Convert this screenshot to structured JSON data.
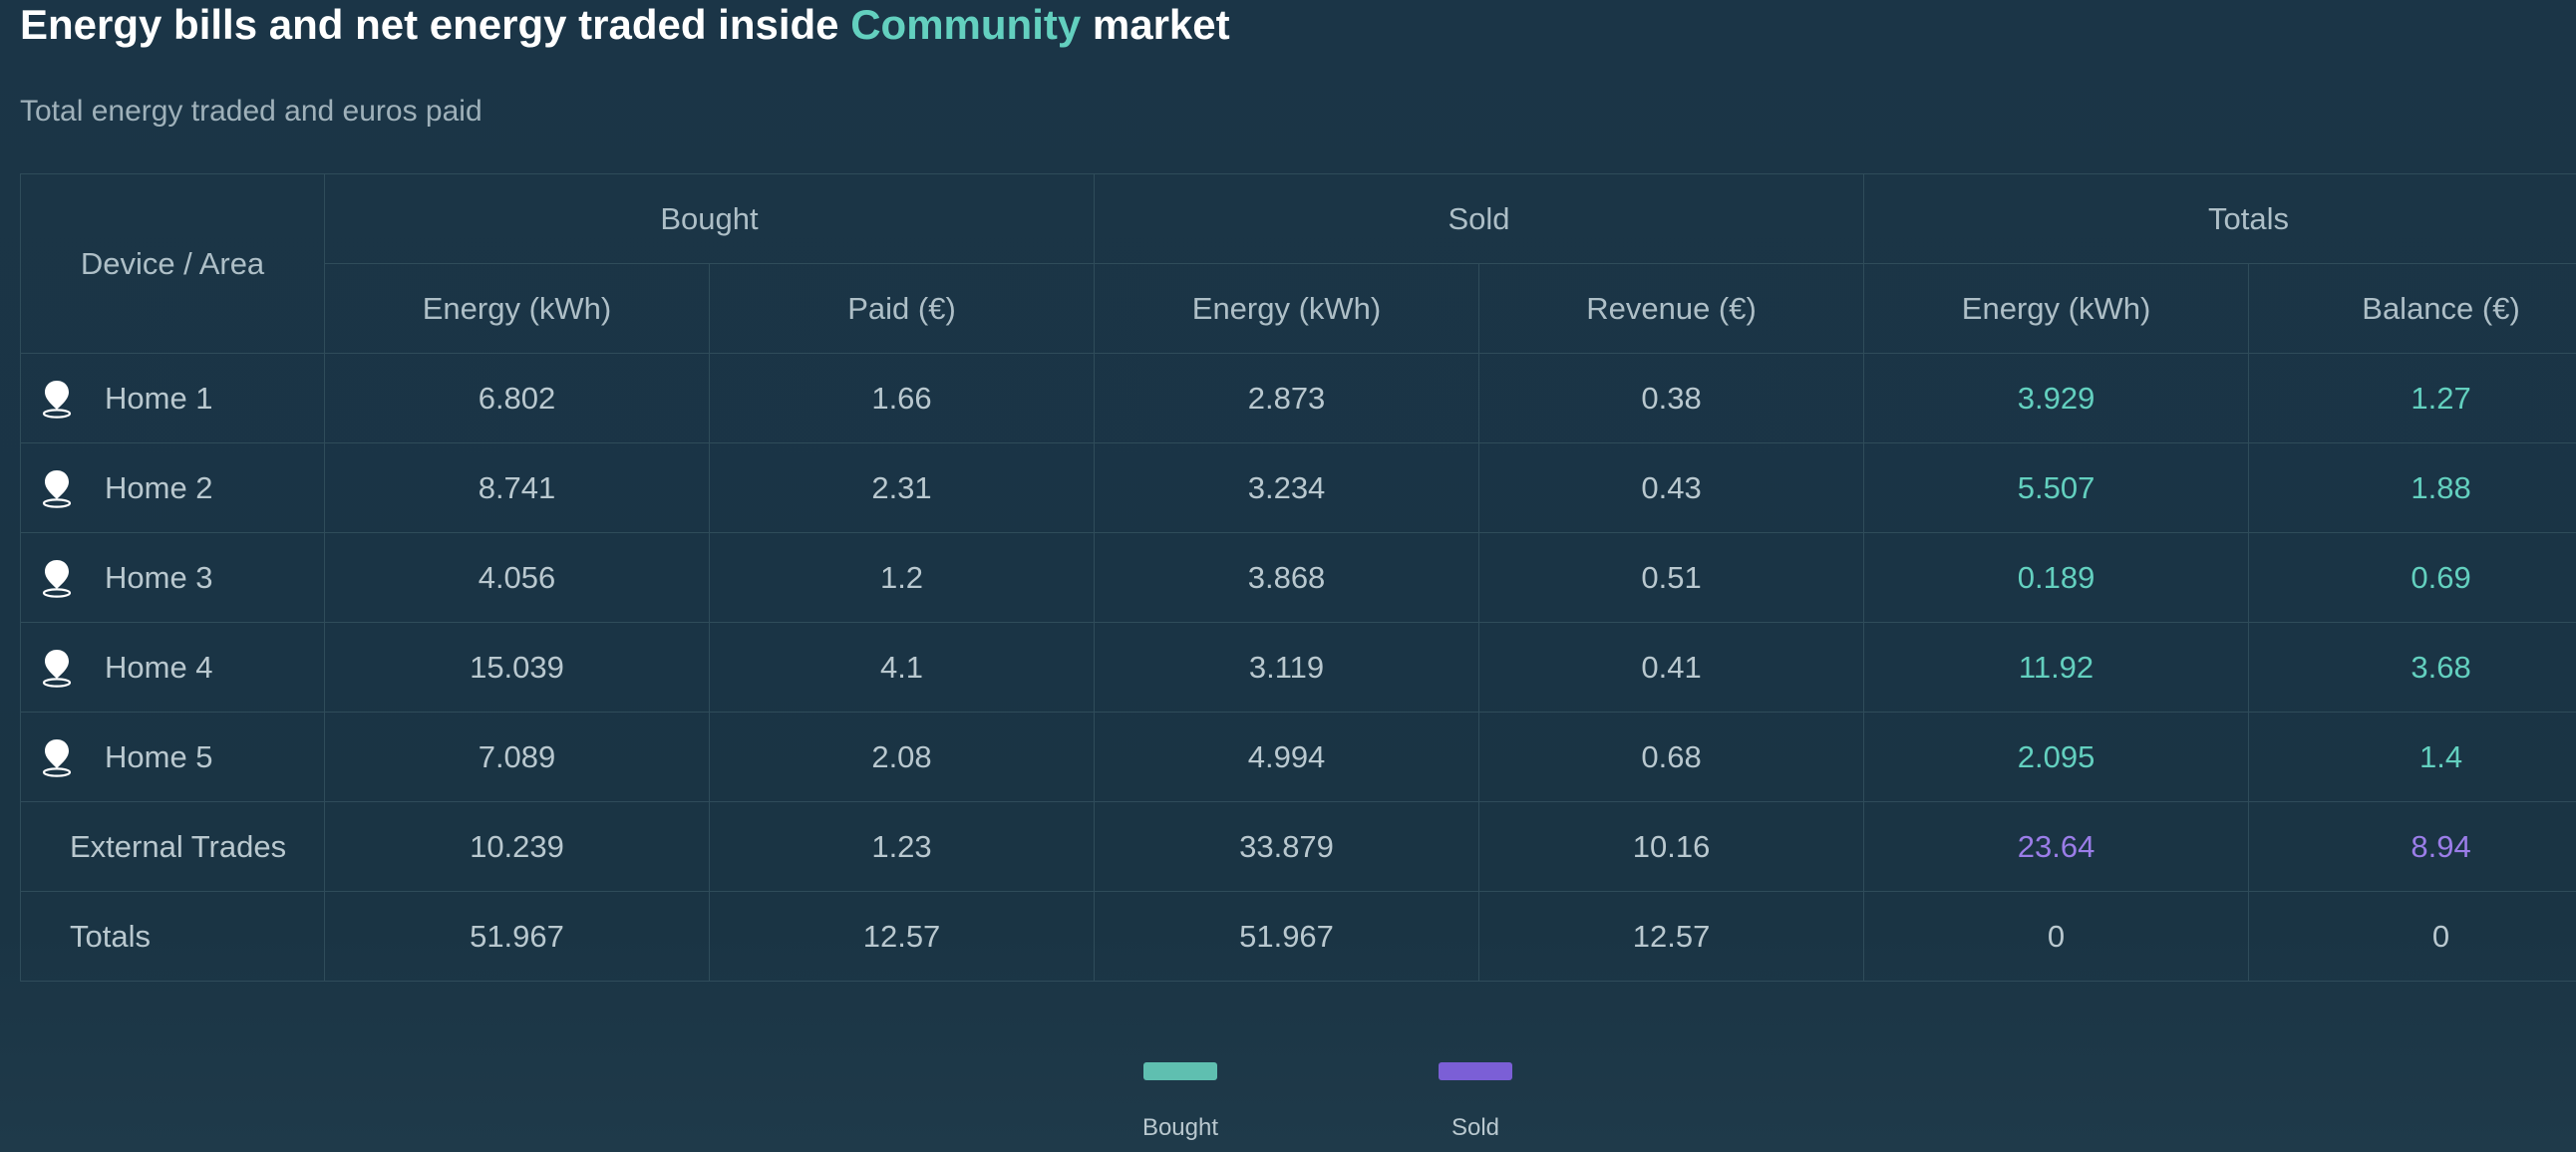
{
  "header": {
    "title_prefix": "Energy bills and net energy traded inside ",
    "title_accent": "Community",
    "title_suffix": " market",
    "subtitle": "Total energy traded and euros paid"
  },
  "table": {
    "device_header": "Device / Area",
    "groups": {
      "bought": "Bought",
      "sold": "Sold",
      "totals": "Totals"
    },
    "columns": {
      "bought_energy": "Energy (kWh)",
      "bought_paid": "Paid (€)",
      "sold_energy": "Energy (kWh)",
      "sold_revenue": "Revenue (€)",
      "totals_energy": "Energy (kWh)",
      "totals_balance": "Balance (€)"
    },
    "rows": [
      {
        "name": "Home 1",
        "bought_energy": "6.802",
        "bought_paid": "1.66",
        "sold_energy": "2.873",
        "sold_revenue": "0.38",
        "totals_energy": "3.929",
        "totals_balance": "1.27"
      },
      {
        "name": "Home 2",
        "bought_energy": "8.741",
        "bought_paid": "2.31",
        "sold_energy": "3.234",
        "sold_revenue": "0.43",
        "totals_energy": "5.507",
        "totals_balance": "1.88"
      },
      {
        "name": "Home 3",
        "bought_energy": "4.056",
        "bought_paid": "1.2",
        "sold_energy": "3.868",
        "sold_revenue": "0.51",
        "totals_energy": "0.189",
        "totals_balance": "0.69"
      },
      {
        "name": "Home 4",
        "bought_energy": "15.039",
        "bought_paid": "4.1",
        "sold_energy": "3.119",
        "sold_revenue": "0.41",
        "totals_energy": "11.92",
        "totals_balance": "3.68"
      },
      {
        "name": "Home 5",
        "bought_energy": "7.089",
        "bought_paid": "2.08",
        "sold_energy": "4.994",
        "sold_revenue": "0.68",
        "totals_energy": "2.095",
        "totals_balance": "1.4"
      }
    ],
    "external": {
      "name": "External Trades",
      "bought_energy": "10.239",
      "bought_paid": "1.23",
      "sold_energy": "33.879",
      "sold_revenue": "10.16",
      "totals_energy": "23.64",
      "totals_balance": "8.94"
    },
    "totals": {
      "name": "Totals",
      "bought_energy": "51.967",
      "bought_paid": "12.57",
      "sold_energy": "51.967",
      "sold_revenue": "12.57",
      "totals_energy": "0",
      "totals_balance": "0"
    }
  },
  "legend": {
    "bought": {
      "label": "Bought",
      "color": "#5fbfb0"
    },
    "sold": {
      "label": "Sold",
      "color": "#7b5fd6"
    }
  },
  "colors": {
    "background": "#1b3547",
    "accent_teal": "#63d0bf",
    "accent_purple": "#9b7de8",
    "grid": "#2f4c5a"
  },
  "icons": {
    "home_row": "location-pin-icon"
  }
}
